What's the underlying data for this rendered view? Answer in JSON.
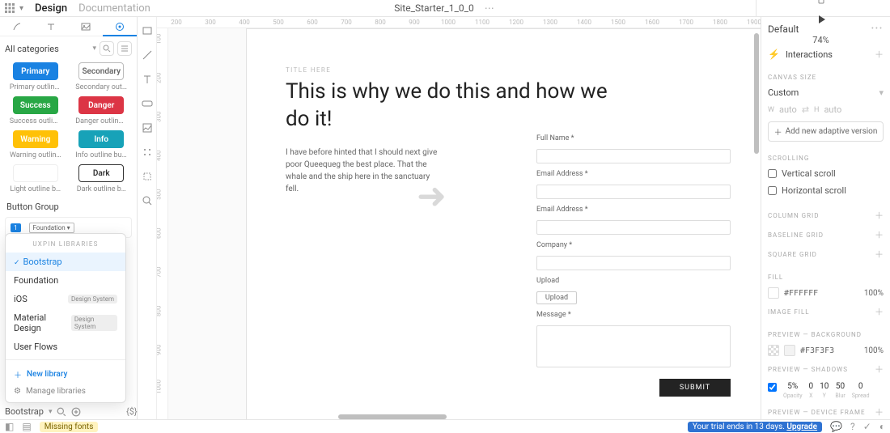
{
  "topbar": {
    "tab_design": "Design",
    "tab_documentation": "Documentation",
    "doc_name": "Site_Starter_1_0_0",
    "zoom": "74%"
  },
  "left": {
    "category": "All categories",
    "section_button_group": "Button Group",
    "comp": {
      "primary": "Primary",
      "primary_lbl": "Primary outline…",
      "secondary": "Secondary",
      "secondary_lbl": "Secondary outl…",
      "success": "Success",
      "success_lbl": "Success outline…",
      "danger": "Danger",
      "danger_lbl": "Danger outline…",
      "warning": "Warning",
      "warning_lbl": "Warning outlin…",
      "info": "Info",
      "info_lbl": "Info outline but…",
      "light": "",
      "light_lbl": "Light outline b…",
      "dark": "Dark",
      "dark_lbl": "Dark outline b…"
    },
    "bottom_lib": "Bootstrap",
    "bottom_paren": "{$}"
  },
  "libraries_popover": {
    "title": "UXPIN LIBRARIES",
    "items": [
      {
        "label": "Bootstrap",
        "selected": true
      },
      {
        "label": "Foundation"
      },
      {
        "label": "iOS",
        "badge": "Design System"
      },
      {
        "label": "Material Design",
        "badge": "Design System"
      },
      {
        "label": "User Flows"
      }
    ],
    "new_library": "New library",
    "manage": "Manage libraries"
  },
  "canvas": {
    "ruler_h": [
      "200",
      "300",
      "400",
      "500",
      "600",
      "700",
      "800",
      "900",
      "1000",
      "1100",
      "1200",
      "1300",
      "1400",
      "1500",
      "1600",
      "1700",
      "1800",
      "1900"
    ],
    "ruler_v": [
      "100",
      "200",
      "300",
      "400",
      "500",
      "600",
      "700",
      "800",
      "900",
      "1000"
    ],
    "overline": "TITLE HERE",
    "headline": "This is why we do this and how we do it!",
    "body": "I have before hinted that I should next give poor Queequeg the best place. That the whale and the ship here in the sanctuary fell.",
    "form": {
      "full_name": "Full Name *",
      "email1": "Email Address *",
      "email2": "Email Address *",
      "company": "Company *",
      "upload_lbl": "Upload",
      "upload_btn": "Upload",
      "message": "Message *",
      "submit": "SUBMIT"
    }
  },
  "right": {
    "default": "Default",
    "sec_interactions": "Interactions",
    "sec_canvas_size": "CANVAS SIZE",
    "canvas_size_value": "Custom",
    "w_lbl": "W",
    "w_val": "auto",
    "h_lbl": "H",
    "h_val": "auto",
    "add_version": "Add new adaptive version",
    "sec_scrolling": "SCROLLING",
    "vertical_scroll": "Vertical scroll",
    "horizontal_scroll": "Horizontal scroll",
    "sec_column_grid": "COLUMN GRID",
    "sec_baseline_grid": "BASELINE GRID",
    "sec_square_grid": "SQUARE GRID",
    "sec_fill": "FILL",
    "fill_hex": "#FFFFFF",
    "fill_pct": "100%",
    "sec_image_fill": "IMAGE FILL",
    "sec_preview_bg": "PREVIEW — BACKGROUND",
    "bg_hex": "#F3F3F3",
    "bg_pct": "100%",
    "sec_preview_shadows": "PREVIEW — SHADOWS",
    "shadow": {
      "opacity_v": "5%",
      "x_v": "0",
      "y_v": "10",
      "blur_v": "50",
      "spread_v": "0",
      "opacity_l": "Opacity",
      "x_l": "X",
      "y_l": "Y",
      "blur_l": "Blur",
      "spread_l": "Spread"
    },
    "sec_device_frame": "PREVIEW — DEVICE FRAME"
  },
  "status": {
    "missing_fonts": "Missing fonts",
    "trial_text": "Your trial ends in 13 days.",
    "upgrade": "Upgrade"
  }
}
